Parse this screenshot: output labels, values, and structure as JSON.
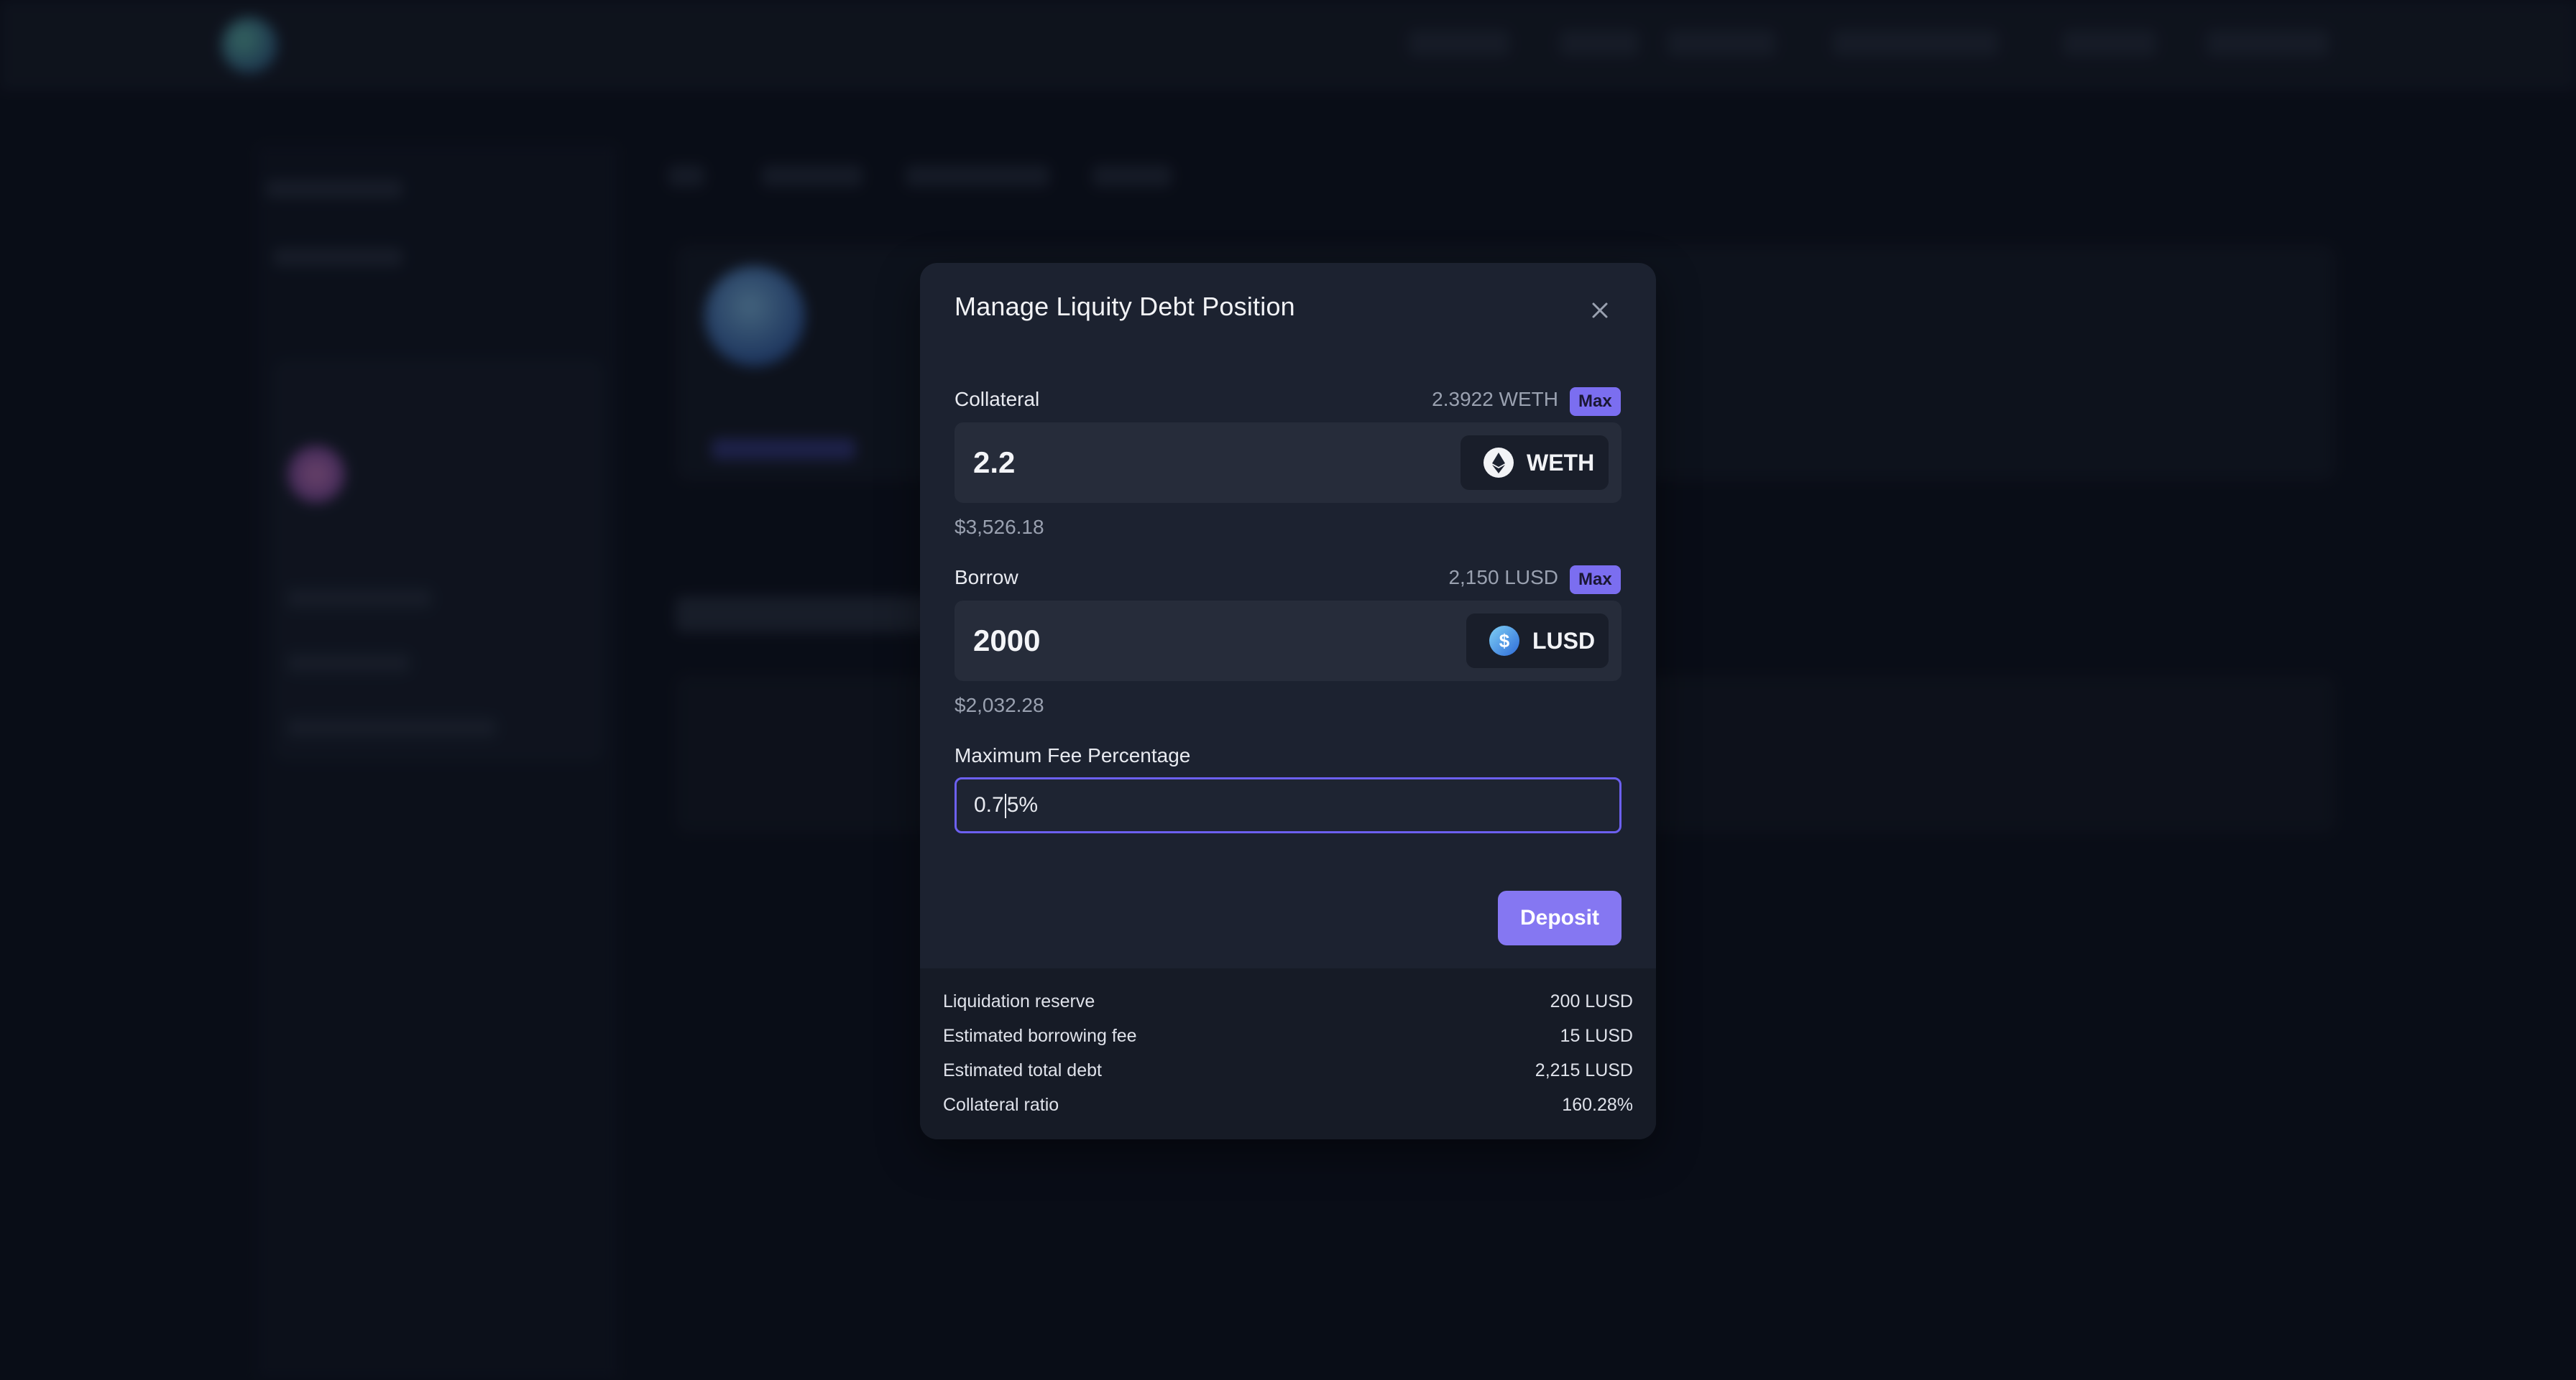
{
  "modal": {
    "title": "Manage Liquity Debt Position",
    "collateral": {
      "label": "Collateral",
      "balance": "2.3922 WETH",
      "max_label": "Max",
      "amount": "2.2",
      "token": "WETH",
      "token_icon": "ethereum-icon",
      "usd_value": "$3,526.18"
    },
    "borrow": {
      "label": "Borrow",
      "balance": "2,150 LUSD",
      "max_label": "Max",
      "amount": "2000",
      "token": "LUSD",
      "token_icon": "lusd-icon",
      "usd_value": "$2,032.28"
    },
    "fee": {
      "label": "Maximum Fee Percentage",
      "value_before_caret": "0.7",
      "value_after_caret": "5%"
    },
    "deposit_label": "Deposit",
    "summary": [
      {
        "label": "Liquidation reserve",
        "value": "200 LUSD"
      },
      {
        "label": "Estimated borrowing fee",
        "value": "15 LUSD"
      },
      {
        "label": "Estimated total debt",
        "value": "2,215 LUSD"
      },
      {
        "label": "Collateral ratio",
        "value": "160.28%"
      }
    ]
  },
  "colors": {
    "accent": "#7b6ef0",
    "focus_ring": "#6c60f0",
    "modal_bg": "#1c2230",
    "page_bg": "#0f1320"
  }
}
